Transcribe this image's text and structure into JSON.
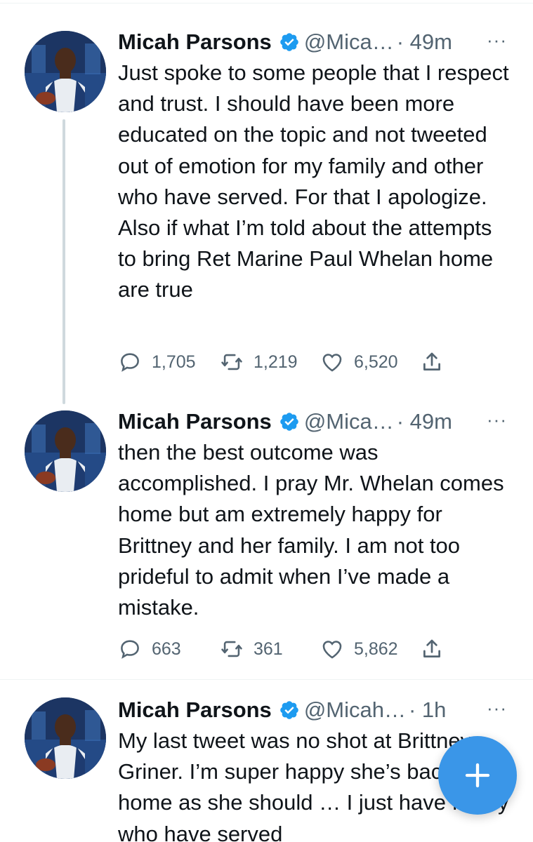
{
  "tweets": [
    {
      "name": "Micah Parsons",
      "handle": "@Mica…",
      "time": "· 49m",
      "more": "···",
      "text": "Just spoke to some people that I respect and trust. I should have been more educated on the topic and not tweeted out of emotion for my family and other who have served. For that I apologize. Also if what I’m told about the attempts to bring Ret Marine Paul Whelan home are true",
      "replies": "1,705",
      "retweets": "1,219",
      "likes": "6,520"
    },
    {
      "name": "Micah Parsons",
      "handle": "@Mica…",
      "time": "· 49m",
      "more": "···",
      "text": "then the best outcome was accomplished. I pray Mr. Whelan comes home but am extremely happy for Brittney and her family.  I am not too prideful to admit when I’ve made a mistake.",
      "replies": "663",
      "retweets": "361",
      "likes": "5,862"
    },
    {
      "name": "Micah Parsons",
      "handle": "@Micah…",
      "time": "· 1h",
      "more": "···",
      "text": "My last tweet was no shot at Brittney Griner. I’m super happy she’s back home as she should … I just have family who have served"
    }
  ],
  "colors": {
    "verified": "#1d9bf0",
    "muted": "#536471",
    "fab": "#3a96e8"
  },
  "icons": [
    "verified-badge-icon",
    "more-icon",
    "reply-icon",
    "retweet-icon",
    "like-icon",
    "share-icon",
    "compose-plus-icon"
  ]
}
